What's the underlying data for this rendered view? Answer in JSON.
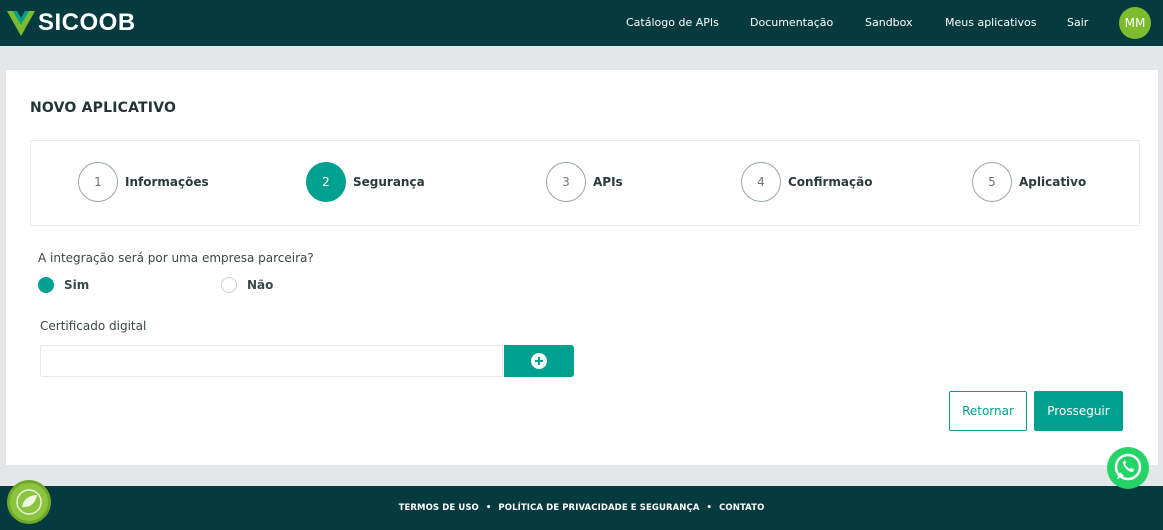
{
  "header": {
    "brand": "SICOOB",
    "nav": [
      {
        "label": "Catálogo de APIs",
        "id": "catalogo"
      },
      {
        "label": "Documentação",
        "id": "documentacao"
      },
      {
        "label": "Sandbox",
        "id": "sandbox"
      },
      {
        "label": "Meus aplicativos",
        "id": "meus-aplicativos"
      },
      {
        "label": "Sair",
        "id": "sair"
      }
    ],
    "avatar_initials": "MM"
  },
  "page": {
    "title": "NOVO APLICATIVO"
  },
  "stepper": {
    "active_step": 2,
    "steps": [
      {
        "number": "1",
        "label": "Informações"
      },
      {
        "number": "2",
        "label": "Segurança"
      },
      {
        "number": "3",
        "label": "APIs"
      },
      {
        "number": "4",
        "label": "Confirmação"
      },
      {
        "number": "5",
        "label": "Aplicativo"
      }
    ]
  },
  "form": {
    "question": "A integração será por uma empresa parceira?",
    "options": [
      {
        "label": "Sim",
        "checked": true
      },
      {
        "label": "Não",
        "checked": false
      }
    ],
    "certificate_label": "Certificado digital",
    "certificate_value": ""
  },
  "actions": {
    "back_label": "Retornar",
    "next_label": "Prosseguir"
  },
  "footer": {
    "links": [
      "TERMOS DE USO",
      "POLÍTICA DE PRIVACIDADE E SEGURANÇA",
      "CONTATO"
    ],
    "separator": "•"
  },
  "colors": {
    "header_bg": "#053b3f",
    "accent": "#00a091",
    "avatar": "#7dbc2e",
    "page_bg": "#e4e7ea"
  },
  "icons": {
    "logo": "sicoob-logo-icon",
    "add": "plus-circle-icon",
    "chat": "whatsapp-icon",
    "badge": "sustainability-badge-icon"
  }
}
